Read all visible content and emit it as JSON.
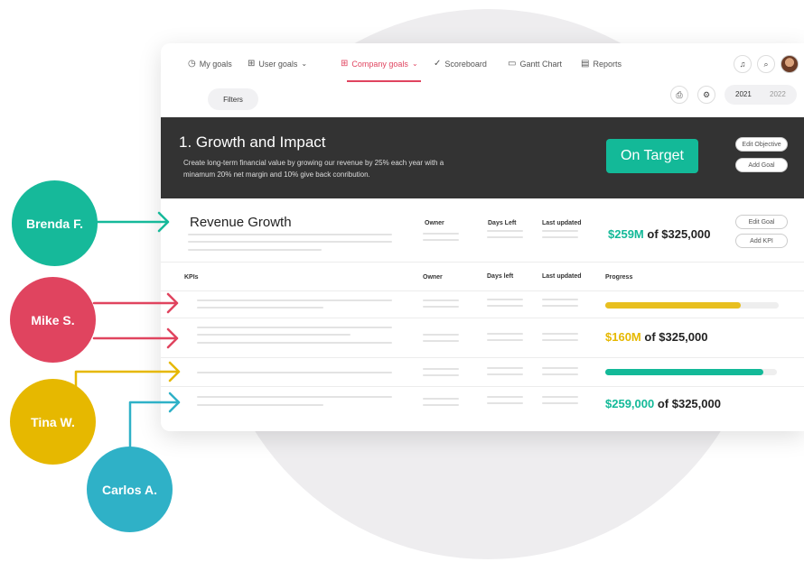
{
  "nav": {
    "my_goals": "My goals",
    "user_goals": "User goals",
    "company_goals": "Company goals",
    "scoreboard": "Scoreboard",
    "gantt_chart": "Gantt Chart",
    "reports": "Reports"
  },
  "toolbar": {
    "filters": "Filters",
    "years": [
      "2021",
      "2022"
    ],
    "selected_year": "2021"
  },
  "objective": {
    "title": "1. Growth and Impact",
    "description": "Create long-term financial value by growing our revenue by 25% each year with a minamum 20% net margin and 10% give back conribution.",
    "status": "On Target",
    "edit_label": "Edit Objective",
    "add_goal_label": "Add Goal"
  },
  "goal": {
    "title": "Revenue Growth",
    "owner_label": "Owner",
    "days_left_label": "Days Left",
    "last_updated_label": "Last updated",
    "current": "$259M",
    "target_text": "of $325,000",
    "edit_label": "Edit Goal",
    "add_kpi_label": "Add KPI"
  },
  "kpi_table": {
    "headers": [
      "KPIs",
      "Owner",
      "Days left",
      "Last updated",
      "Progress"
    ],
    "rows": [
      {
        "progress": 0.78,
        "color": "#e8bf1f"
      },
      {
        "current": "$160M",
        "target_text": "of $325,000",
        "current_color": "#e6b800"
      },
      {
        "progress": 0.92,
        "color": "#13b998"
      },
      {
        "current": "$259,000",
        "target_text": "of $325,000",
        "current_color": "#13b998"
      }
    ]
  },
  "people": [
    {
      "name": "Brenda F.",
      "color": "#16b99a"
    },
    {
      "name": "Mike S.",
      "color": "#e0445f"
    },
    {
      "name": "Tina W.",
      "color": "#e6b800"
    },
    {
      "name": "Carlos A.",
      "color": "#2fb1c7"
    }
  ],
  "colors": {
    "accent_red": "#e0445f",
    "accent_green": "#13b998",
    "hero_bg": "#333333"
  },
  "icons": {
    "my_goals": "clock-icon",
    "user_goals": "grid-icon",
    "company_goals": "grid-icon",
    "scoreboard": "check-circle-icon",
    "gantt_chart": "gantt-icon",
    "reports": "document-icon",
    "bell": "bell-icon",
    "search": "search-icon",
    "print": "printer-icon",
    "settings": "gear-icon"
  }
}
